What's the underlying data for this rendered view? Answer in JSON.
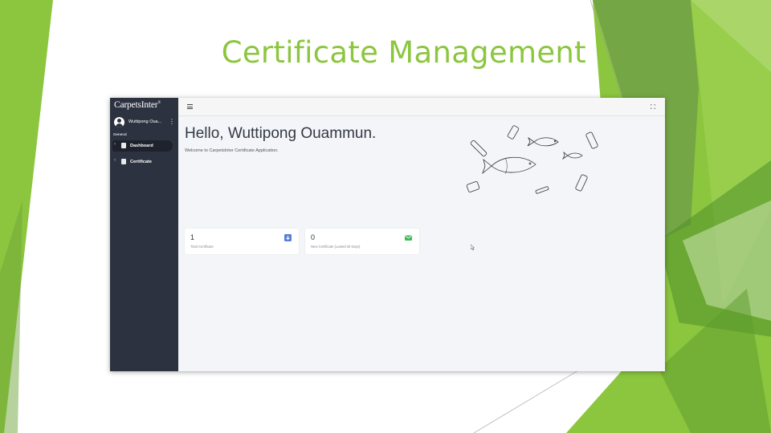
{
  "slide": {
    "title": "Certificate Management"
  },
  "colors": {
    "accent_green": "#8cc63f",
    "sidebar": "#2d3240",
    "content_bg": "#f3f5f8",
    "total_icon": "#5b7fd6",
    "new_icon": "#3dbb58"
  },
  "app": {
    "brand": "CarpetsInter",
    "brand_mark": "®",
    "user": {
      "name": "Wuttipong Oua...",
      "menu_icon": "kebab-icon"
    },
    "sidebar": {
      "section": "General",
      "items": [
        {
          "label": "Dashboard",
          "icon": "dashboard-icon",
          "active": true
        },
        {
          "label": "Certificate",
          "icon": "document-icon",
          "active": false
        }
      ]
    },
    "topbar": {
      "menu_icon": "hamburger-icon",
      "fullscreen_icon": "fullscreen-icon"
    },
    "main": {
      "greeting": "Hello, Wuttipong Ouammun.",
      "welcome": "Welcome to CarpetsInter Certificate Application.",
      "cards": [
        {
          "value": "1",
          "label": "Total Certificate",
          "icon": "certificate-icon"
        },
        {
          "value": "0",
          "label": "New Certificate (Lasted 30 Days)",
          "icon": "mail-icon"
        }
      ]
    }
  }
}
